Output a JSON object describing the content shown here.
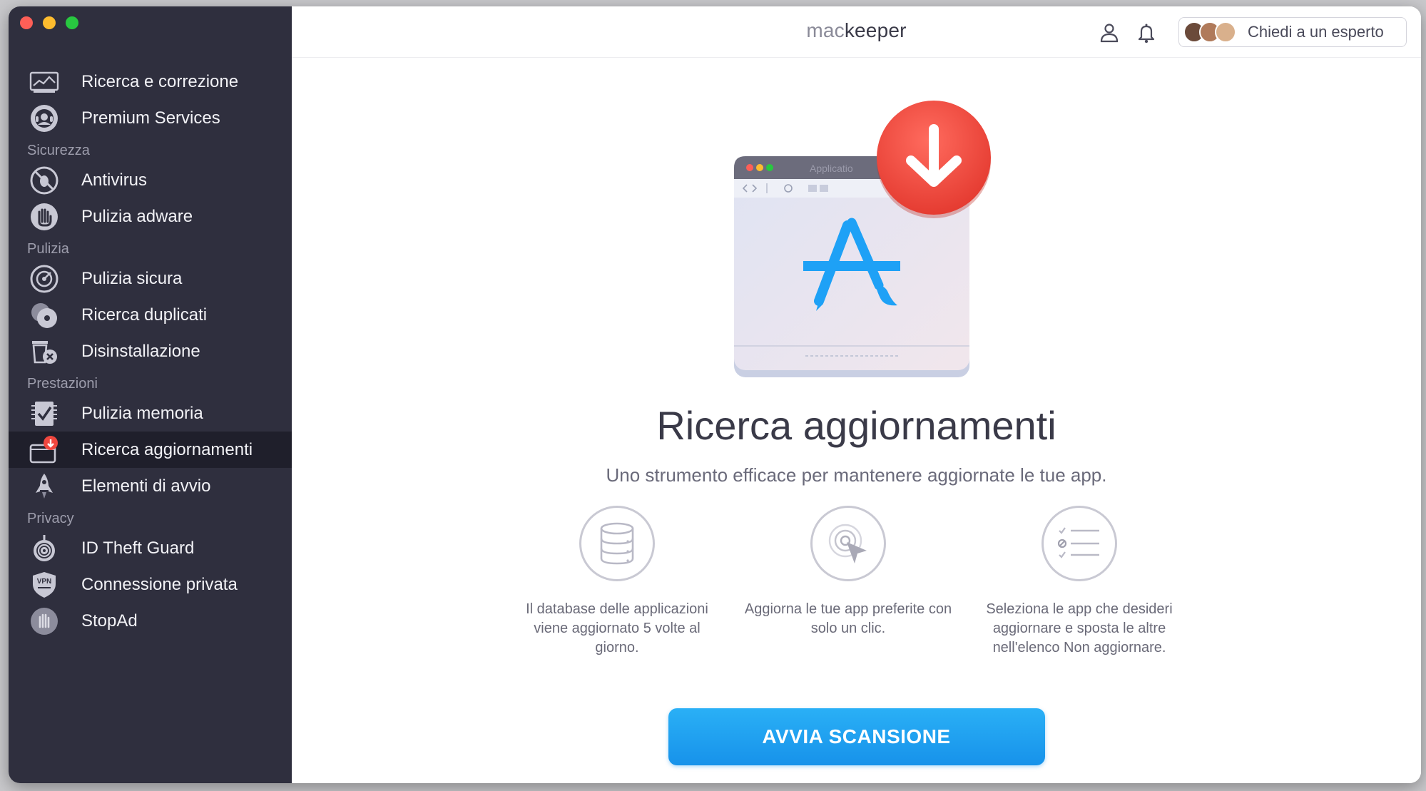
{
  "app": {
    "brand_part1": "mac",
    "brand_part2": "keeper"
  },
  "sidebar": {
    "items": [
      {
        "label": "Ricerca e correzione",
        "icon": "monitor-scan-icon"
      },
      {
        "label": "Premium Services",
        "icon": "headset-icon"
      }
    ],
    "sections": [
      {
        "title": "Sicurezza",
        "items": [
          {
            "label": "Antivirus",
            "icon": "no-bug-icon"
          },
          {
            "label": "Pulizia adware",
            "icon": "hand-stop-icon"
          }
        ]
      },
      {
        "title": "Pulizia",
        "items": [
          {
            "label": "Pulizia sicura",
            "icon": "disk-clean-icon"
          },
          {
            "label": "Ricerca duplicati",
            "icon": "duplicate-disks-icon"
          },
          {
            "label": "Disinstallazione",
            "icon": "uninstall-trash-icon"
          }
        ]
      },
      {
        "title": "Prestazioni",
        "items": [
          {
            "label": "Pulizia memoria",
            "icon": "memory-check-icon"
          },
          {
            "label": "Ricerca aggiornamenti",
            "icon": "update-tracker-icon",
            "active": true
          },
          {
            "label": "Elementi di avvio",
            "icon": "rocket-icon"
          }
        ]
      },
      {
        "title": "Privacy",
        "items": [
          {
            "label": "ID Theft Guard",
            "icon": "fingerprint-icon"
          },
          {
            "label": "Connessione privata",
            "icon": "vpn-shield-icon"
          },
          {
            "label": "StopAd",
            "icon": "stopad-hand-icon"
          }
        ]
      }
    ]
  },
  "topbar": {
    "expert_label": "Chiedi a un esperto"
  },
  "hero": {
    "illustration_window_title": "Applicatio",
    "title": "Ricerca aggiornamenti",
    "subtitle": "Uno strumento efficace per mantenere aggiornate le tue app."
  },
  "features": [
    {
      "icon": "database-icon",
      "text": "Il database delle applicazioni viene aggiornato 5 volte al giorno."
    },
    {
      "icon": "click-target-icon",
      "text": "Aggiorna le tue app preferite con solo un clic."
    },
    {
      "icon": "checklist-icon",
      "text": "Seleziona le app che desideri aggiornare e sposta le altre nell'elenco Non aggiornare."
    }
  ],
  "cta": {
    "label": "AVVIA SCANSIONE"
  },
  "colors": {
    "sidebar_bg": "#2f2f3e",
    "sidebar_active": "#1f1f2b",
    "accent_blue": "#1a9bee",
    "badge_red": "#f0473f"
  }
}
